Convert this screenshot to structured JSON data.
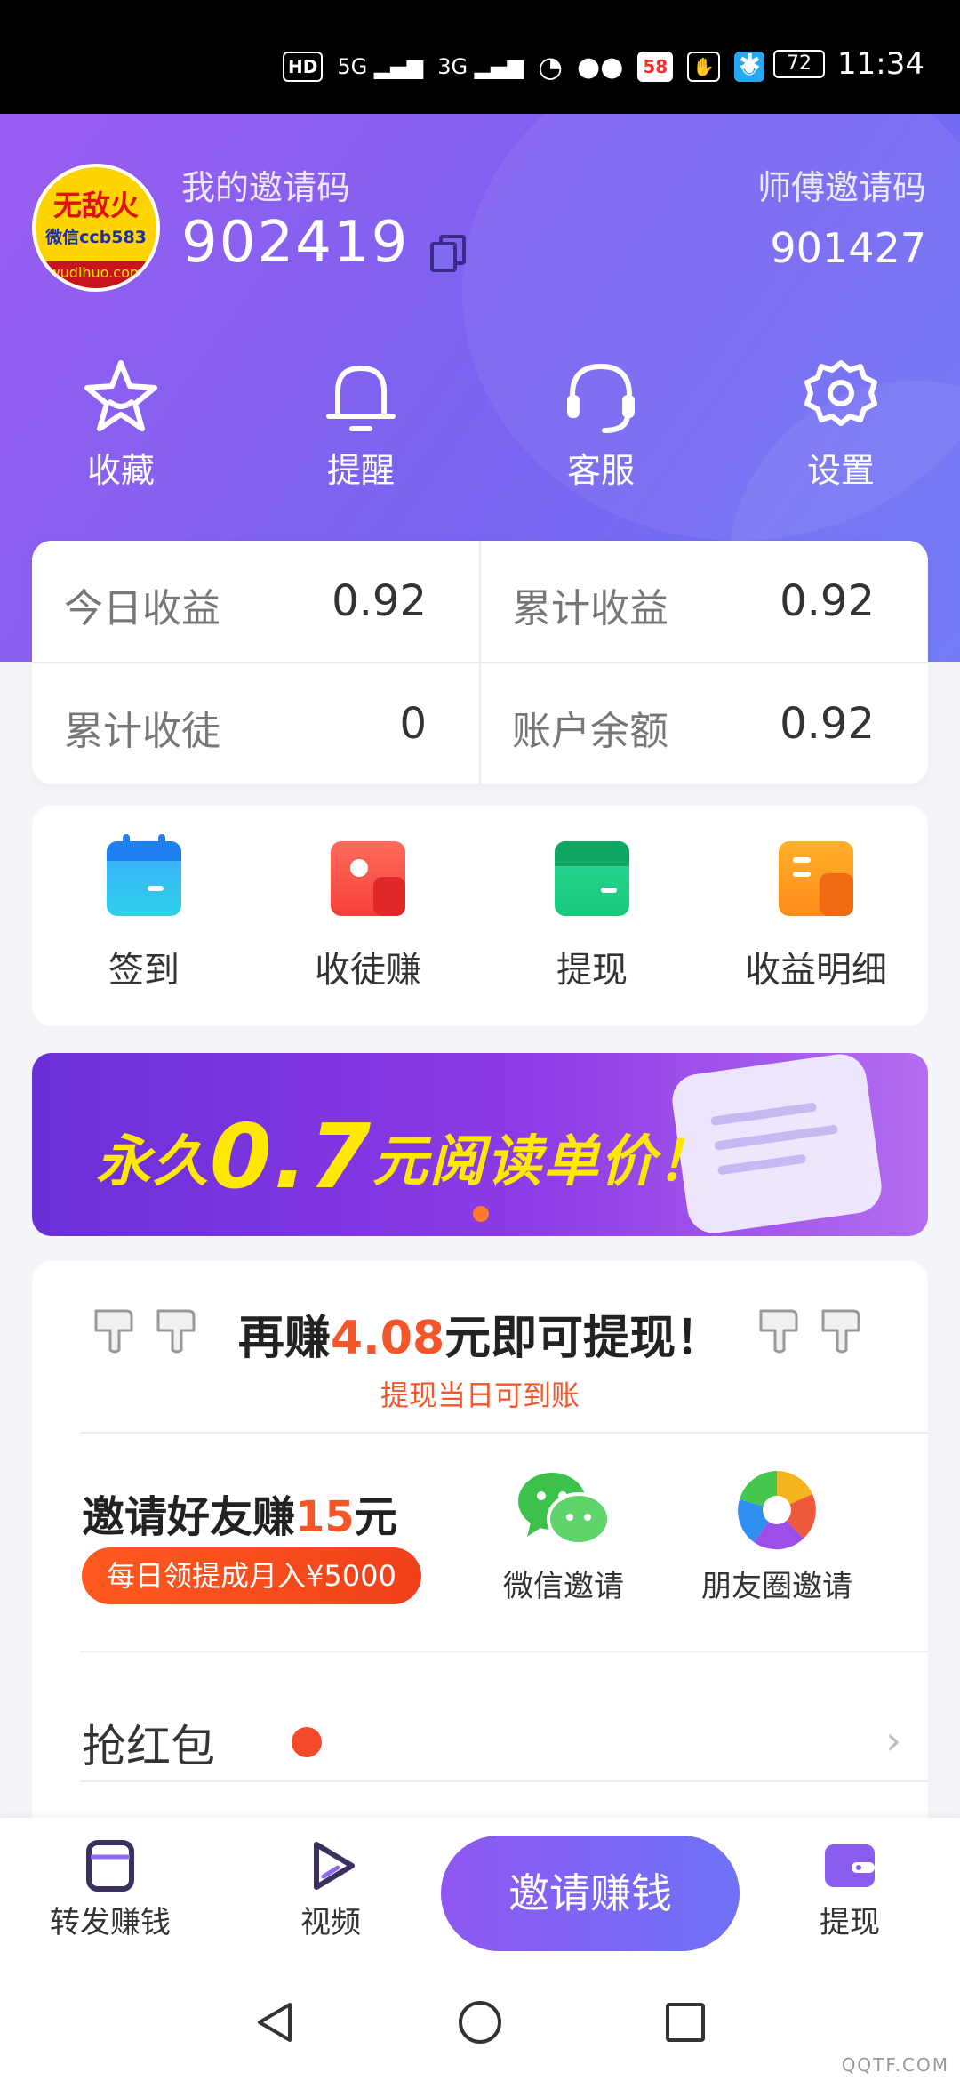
{
  "status_bar": {
    "indicators": [
      "HD",
      "5G",
      "3G"
    ],
    "app_badges": [
      "58"
    ],
    "battery": "72",
    "time": "11:34"
  },
  "profile": {
    "avatar": {
      "line1": "无敌火",
      "line2": "微信ccb583",
      "line3": "wudihuo.com"
    },
    "my_code_label": "我的邀请码",
    "my_code": "902419",
    "master_code_label": "师傅邀请码",
    "master_code": "901427"
  },
  "quick_actions": [
    {
      "label": "收藏",
      "icon": "star-icon"
    },
    {
      "label": "提醒",
      "icon": "bell-icon"
    },
    {
      "label": "客服",
      "icon": "headset-icon"
    },
    {
      "label": "设置",
      "icon": "gear-icon"
    }
  ],
  "stats": [
    {
      "label": "今日收益",
      "value": "0.92"
    },
    {
      "label": "累计收益",
      "value": "0.92"
    },
    {
      "label": "累计收徒",
      "value": "0"
    },
    {
      "label": "账户余额",
      "value": "0.92"
    }
  ],
  "features": [
    {
      "label": "签到",
      "icon": "calendar-icon"
    },
    {
      "label": "收徒赚",
      "icon": "recruit-icon"
    },
    {
      "label": "提现",
      "icon": "wallet-icon"
    },
    {
      "label": "收益明细",
      "icon": "ledger-icon"
    }
  ],
  "banner": {
    "prefix": "永久",
    "price": "0.7",
    "suffix": "元阅读单价！",
    "colors": {
      "text": "#ffe800",
      "start": "#6a2fd8",
      "end": "#b46cf0"
    }
  },
  "withdraw": {
    "prefix": "再赚",
    "amount": "4.08",
    "suffix": "元即可提现！",
    "subtitle": "提现当日可到账"
  },
  "invite": {
    "title_prefix": "邀请好友赚",
    "title_amount": "15",
    "title_suffix": "元",
    "badge": "每日领提成月入¥5000",
    "wechat_label": "微信邀请",
    "moments_label": "朋友圈邀请"
  },
  "red_packet": {
    "label": "抢红包"
  },
  "bottom_nav": {
    "items": [
      {
        "label": "转发赚钱",
        "icon": "share-doc-icon"
      },
      {
        "label": "视频",
        "icon": "play-icon"
      },
      {
        "label": "提现",
        "icon": "wallet-icon"
      }
    ],
    "invite_button": "邀请赚钱"
  },
  "watermark": "QQTF.COM",
  "colors": {
    "accent": "#7b63f0",
    "highlight": "#f2562a"
  }
}
